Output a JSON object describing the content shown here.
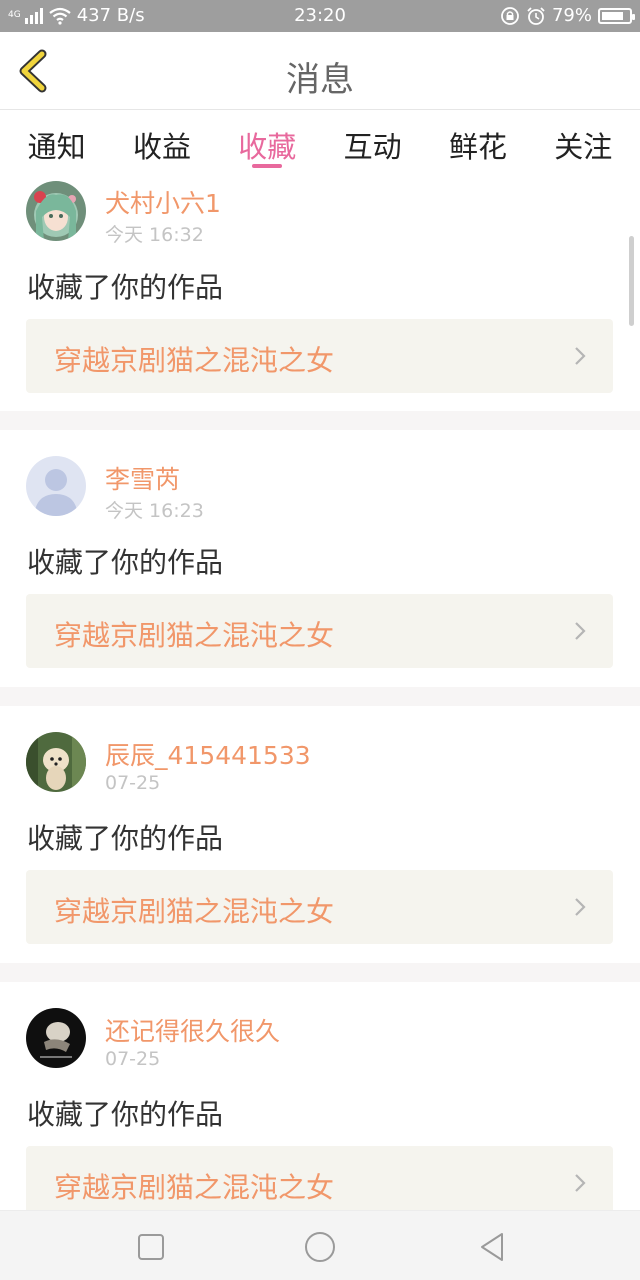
{
  "status_bar": {
    "network_type": "4G",
    "speed": "437 B/s",
    "time": "23:20",
    "battery": "79%",
    "battery_level": 0.79
  },
  "header": {
    "title": "消息",
    "back_icon": "chevron-left-icon",
    "accent_color": "#f0d43c"
  },
  "tabs": [
    {
      "label": "通知",
      "active": false
    },
    {
      "label": "收益",
      "active": false
    },
    {
      "label": "收藏",
      "active": true
    },
    {
      "label": "互动",
      "active": false
    },
    {
      "label": "鲜花",
      "active": false
    },
    {
      "label": "关注",
      "active": false
    }
  ],
  "colors": {
    "active_tab": "#e8699d",
    "name_and_title": "#f1976a",
    "card_bg": "#f5f4ee"
  },
  "messages": [
    {
      "username": "犬村小六1",
      "time": "今天 16:32",
      "action": "收藏了你的作品",
      "work_title": "穿越京剧猫之混沌之女",
      "avatar": "anime-girl-avatar"
    },
    {
      "username": "李雪芮",
      "time": "今天 16:23",
      "action": "收藏了你的作品",
      "work_title": "穿越京剧猫之混沌之女",
      "avatar": "default-person-avatar"
    },
    {
      "username": "辰辰_415441533",
      "time": "07-25",
      "action": "收藏了你的作品",
      "work_title": "穿越京剧猫之混沌之女",
      "avatar": "dog-photo-avatar"
    },
    {
      "username": "还记得很久很久",
      "time": "07-25",
      "action": "收藏了你的作品",
      "work_title": "穿越京剧猫之混沌之女",
      "avatar": "dark-photo-avatar"
    }
  ],
  "nav_bar": {
    "recent_icon": "square-icon",
    "home_icon": "circle-icon",
    "back_icon": "triangle-back-icon"
  }
}
